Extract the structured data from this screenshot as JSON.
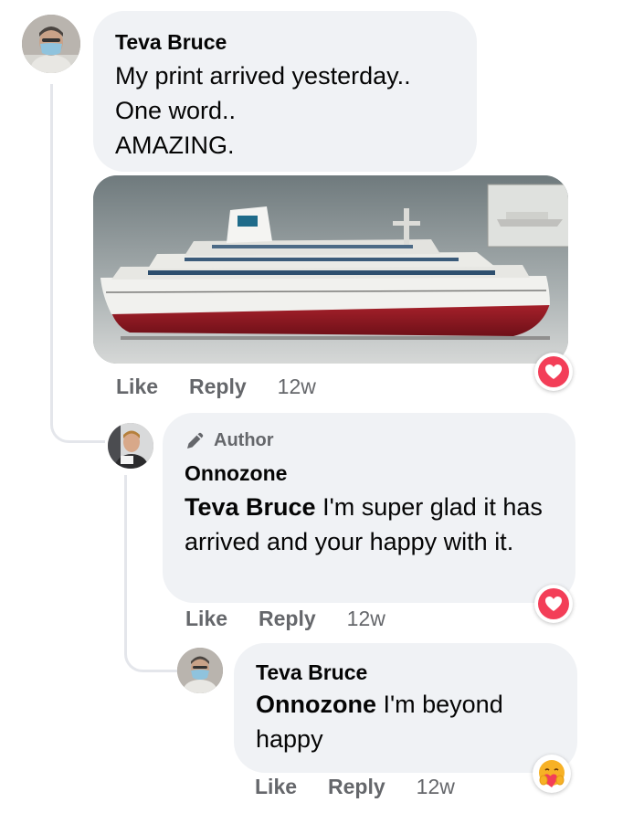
{
  "comment": {
    "author": "Teva Bruce",
    "text_lines": [
      "My print arrived yesterday..",
      "One word..",
      "AMAZING."
    ],
    "avatar": "user-avatar-masked",
    "attachment": "ship-model-photo",
    "actions": {
      "like": "Like",
      "reply": "Reply",
      "time": "12w"
    },
    "reaction": "heart-icon"
  },
  "reply1": {
    "badge_icon": "pencil-icon",
    "badge": "Author",
    "author": "Onnozone",
    "mention": "Teva Bruce",
    "text": " I'm super glad it has arrived and your happy with it.",
    "avatar": "user-avatar",
    "actions": {
      "like": "Like",
      "reply": "Reply",
      "time": "12w"
    },
    "reaction": "heart-icon"
  },
  "reply2": {
    "author": "Teva Bruce",
    "mention": "Onnozone",
    "text": " I'm beyond happy",
    "avatar": "user-avatar-masked",
    "actions": {
      "like": "Like",
      "reply": "Reply",
      "time": "12w"
    },
    "reaction": "care-emoji-icon"
  },
  "colors": {
    "bubble": "#f0f2f5",
    "meta_text": "#65676b",
    "heart": "#f33e58",
    "care": "#f7b125"
  }
}
